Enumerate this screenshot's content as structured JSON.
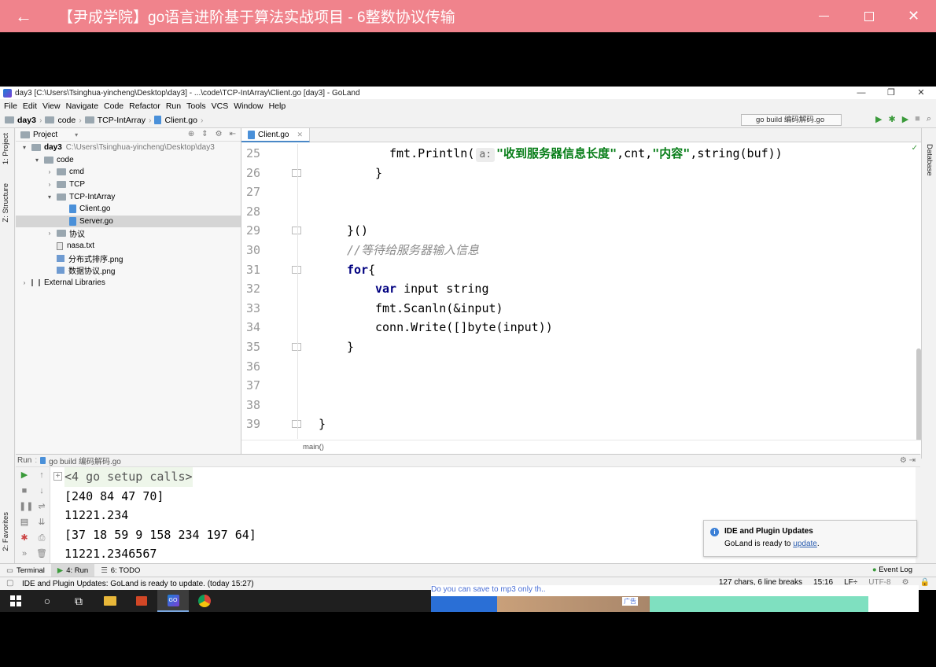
{
  "player": {
    "back_icon": "back-arrow-icon",
    "title": "【尹成学院】go语言进阶基于算法实战项目 - 6整数协议传输",
    "minimize": "minimize-icon",
    "maximize": "maximize-icon",
    "close": "✕"
  },
  "window": {
    "title": "day3 [C:\\Users\\Tsinghua-yincheng\\Desktop\\day3] - ...\\code\\TCP-IntArray\\Client.go [day3] - GoLand",
    "min": "—",
    "restore": "❐",
    "close": "✕"
  },
  "menu": [
    "File",
    "Edit",
    "View",
    "Navigate",
    "Code",
    "Refactor",
    "Run",
    "Tools",
    "VCS",
    "Window",
    "Help"
  ],
  "breadcrumbs": [
    "day3",
    "code",
    "TCP-IntArray",
    "Client.go"
  ],
  "run_config": "go build 编码解码.go",
  "side_tabs": {
    "project": "1: Project",
    "structure": "Z: Structure",
    "favorites": "2: Favorites",
    "database": "Database"
  },
  "project_panel": {
    "title": "Project",
    "tree": [
      {
        "label": "day3",
        "path": "C:\\Users\\Tsinghua-yincheng\\Desktop\\day3",
        "depth": 0,
        "twisty": "▾",
        "icon": "folder"
      },
      {
        "label": "code",
        "depth": 1,
        "twisty": "▾",
        "icon": "folder"
      },
      {
        "label": "cmd",
        "depth": 2,
        "twisty": "›",
        "icon": "folder"
      },
      {
        "label": "TCP",
        "depth": 2,
        "twisty": "›",
        "icon": "folder"
      },
      {
        "label": "TCP-IntArray",
        "depth": 2,
        "twisty": "▾",
        "icon": "folder"
      },
      {
        "label": "Client.go",
        "depth": 3,
        "twisty": "",
        "icon": "go"
      },
      {
        "label": "Server.go",
        "depth": 3,
        "twisty": "",
        "icon": "go",
        "selected": true
      },
      {
        "label": "协议",
        "depth": 2,
        "twisty": "›",
        "icon": "folder"
      },
      {
        "label": "nasa.txt",
        "depth": 2,
        "twisty": "",
        "icon": "file"
      },
      {
        "label": "分布式排序.png",
        "depth": 2,
        "twisty": "",
        "icon": "image"
      },
      {
        "label": "数据协议.png",
        "depth": 2,
        "twisty": "",
        "icon": "image"
      },
      {
        "label": "External Libraries",
        "depth": 0,
        "twisty": "›",
        "icon": "library"
      }
    ]
  },
  "editor": {
    "tab": "Client.go",
    "breadcrumb": "main()",
    "lines": [
      {
        "n": "25",
        "indent": 2,
        "parts": [
          [
            "fmt.Println(",
            ""
          ],
          [
            "a:",
            "hint"
          ],
          [
            "\"收到服务器信息长度\"",
            "str"
          ],
          [
            ",cnt,",
            ""
          ],
          [
            "\"内容\"",
            "str"
          ],
          [
            ",string(buf))",
            ""
          ]
        ]
      },
      {
        "n": "26",
        "indent": 1.5,
        "parts": [
          [
            "}",
            ""
          ]
        ],
        "fold": true
      },
      {
        "n": "27",
        "indent": 0,
        "parts": []
      },
      {
        "n": "28",
        "indent": 0,
        "parts": []
      },
      {
        "n": "29",
        "indent": 0.5,
        "parts": [
          [
            "}()",
            ""
          ]
        ],
        "fold": true
      },
      {
        "n": "30",
        "indent": 0.5,
        "parts": [
          [
            "//等待给服务器输入信息",
            "cm"
          ]
        ]
      },
      {
        "n": "31",
        "indent": 0.5,
        "parts": [
          [
            "for",
            "kw"
          ],
          [
            "{",
            ""
          ]
        ],
        "fold": true
      },
      {
        "n": "32",
        "indent": 1.5,
        "parts": [
          [
            "var",
            "kw"
          ],
          [
            " input string",
            ""
          ]
        ]
      },
      {
        "n": "33",
        "indent": 1.5,
        "parts": [
          [
            "fmt.Scanln(&input)",
            ""
          ]
        ]
      },
      {
        "n": "34",
        "indent": 1.5,
        "parts": [
          [
            "conn.Write([]byte(input))",
            ""
          ]
        ]
      },
      {
        "n": "35",
        "indent": 0.5,
        "parts": [
          [
            "}",
            ""
          ]
        ],
        "fold": true
      },
      {
        "n": "36",
        "indent": 0,
        "parts": []
      },
      {
        "n": "37",
        "indent": 0,
        "parts": []
      },
      {
        "n": "38",
        "indent": 0,
        "parts": []
      },
      {
        "n": "39",
        "indent": -0.5,
        "parts": [
          [
            "}",
            ""
          ]
        ],
        "fold": true
      }
    ]
  },
  "run_panel": {
    "label": "Run",
    "config": "go build 编码解码.go",
    "output": [
      "<4 go setup calls>",
      "[240 84 47 70]",
      "11221.234",
      "[37 18 59 9 158 234 197 64]",
      "11221.2346567"
    ]
  },
  "bottom_tabs": [
    {
      "label": "Terminal",
      "active": false
    },
    {
      "label": "4: Run",
      "active": true
    },
    {
      "label": "6: TODO",
      "active": false
    }
  ],
  "event_log": "Event Log",
  "notification": {
    "title": "IDE and Plugin Updates",
    "body_prefix": "GoLand is ready to ",
    "link": "update",
    "body_suffix": "."
  },
  "status": {
    "message": "IDE and Plugin Updates: GoLand is ready to update. (today 15:27)",
    "chars": "127 chars, 6 line breaks",
    "position": "15:16",
    "line_sep": "LF÷",
    "encoding": "UTF-8"
  },
  "ad": {
    "text": "Do you can save to mp3 only th..",
    "tag": "广告"
  },
  "colors": {
    "player_bar": "#f0838c",
    "keyword": "#000080",
    "string": "#067d17",
    "comment": "#8c8c8c"
  }
}
